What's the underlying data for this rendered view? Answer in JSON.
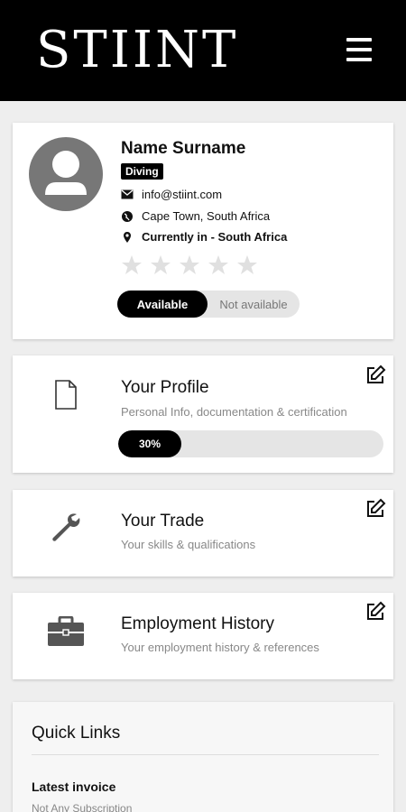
{
  "app": {
    "logo": "STIINT",
    "menu_icon": "hamburger-menu-icon"
  },
  "profile_card": {
    "name": "Name Surname",
    "badge": "Diving",
    "email": "info@stiint.com",
    "location": "Cape Town, South Africa",
    "current_location": "Currently in - South Africa",
    "rating": {
      "value": 0,
      "max": 5
    },
    "availability": {
      "available_label": "Available",
      "unavailable_label": "Not available",
      "selected": "Available"
    }
  },
  "sections": [
    {
      "title": "Your Profile",
      "subtitle": "Personal Info, documentation & certification",
      "icon": "document-icon",
      "progress_label": "30%",
      "progress_value": 0.3
    },
    {
      "title": "Your Trade",
      "subtitle": "Your skills & qualifications",
      "icon": "wrench-icon"
    },
    {
      "title": "Employment History",
      "subtitle": "Your employment history & references",
      "icon": "briefcase-icon"
    }
  ],
  "quick_links": {
    "title": "Quick Links",
    "items": [
      {
        "label": "Latest invoice",
        "sub": "Not Any Subscription"
      }
    ]
  }
}
